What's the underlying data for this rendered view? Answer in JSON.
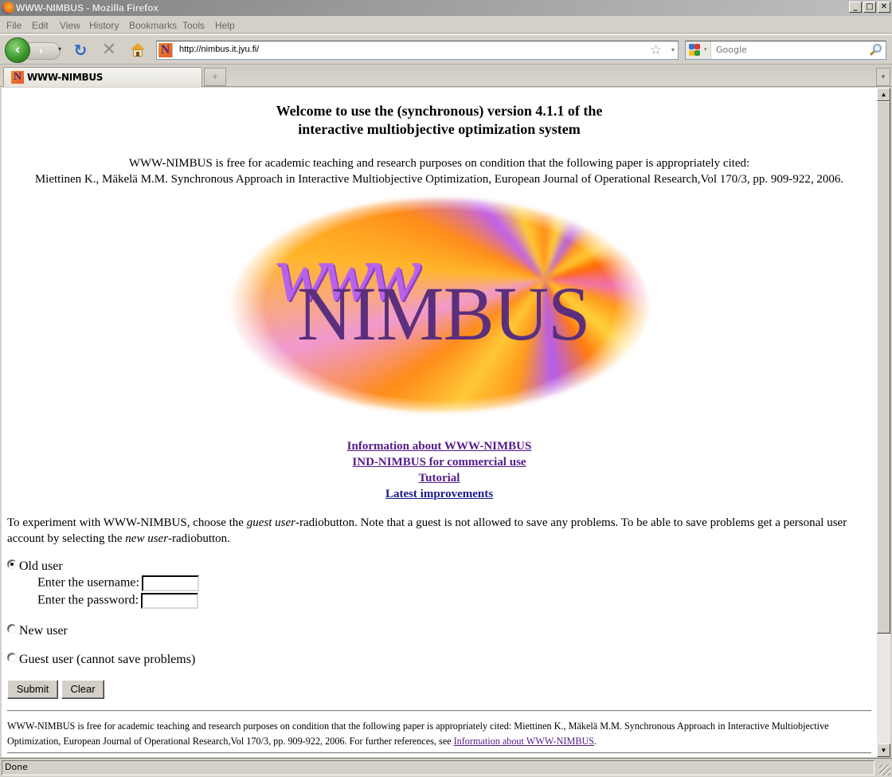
{
  "window": {
    "title": "WWW-NIMBUS - Mozilla Firefox",
    "controls": {
      "minimize": "_",
      "maximize": "□",
      "close": "✕"
    }
  },
  "menubar": {
    "items": [
      {
        "label": "File",
        "accel": "F"
      },
      {
        "label": "Edit",
        "accel": "E"
      },
      {
        "label": "View",
        "accel": "V"
      },
      {
        "label": "History",
        "accel": "s"
      },
      {
        "label": "Bookmarks",
        "accel": "B"
      },
      {
        "label": "Tools",
        "accel": "T"
      },
      {
        "label": "Help",
        "accel": "H"
      }
    ]
  },
  "navbar": {
    "back_glyph": "‹",
    "forward_glyph": "›",
    "reload_glyph": "↻",
    "stop_glyph": "✕",
    "dropdown_glyph": "▾",
    "url": "http://nimbus.it.jyu.fi/",
    "site_icon_letter": "N",
    "bookmark_star": "☆",
    "search_placeholder": "Google"
  },
  "tabs": {
    "items": [
      {
        "label": "WWW-NIMBUS",
        "active": true
      }
    ],
    "new_tab_glyph": "+",
    "all_tabs_glyph": "▾"
  },
  "page": {
    "heading_line1": "Welcome to use the (synchronous) version 4.1.1 of the",
    "heading_line2": "interactive multiobjective optimization system",
    "cite_intro_line1": "WWW-NIMBUS is free for academic teaching and research purposes on condition that the following paper is appropriately cited:",
    "cite_intro_line2": "Miettinen K., Mäkelä M.M. Synchronous Approach in Interactive Multiobjective Optimization, European Journal of Operational Research,Vol 170/3, pp. 909-922, 2006.",
    "logo": {
      "script_text": "www",
      "main_text": "NIMBUS"
    },
    "links": [
      {
        "label": "Information about WWW-NIMBUS",
        "visited": true
      },
      {
        "label": "IND-NIMBUS for commercial use",
        "visited": true
      },
      {
        "label": "Tutorial",
        "visited": true
      },
      {
        "label": "Latest improvements",
        "visited": false
      }
    ],
    "intro": {
      "part1": "To experiment with WWW-NIMBUS, choose the ",
      "em1": "guest user",
      "part2": "-radiobutton. Note that a guest is not allowed to save any problems. To be able to save problems get a personal user account by selecting the ",
      "em2": "new user",
      "part3": "-radiobutton."
    },
    "form": {
      "options": [
        {
          "label": "Old user",
          "checked": true
        },
        {
          "label": "New user",
          "checked": false
        },
        {
          "label": "Guest user (cannot save problems)",
          "checked": false
        }
      ],
      "username_label": "Enter the username:",
      "username_value": "",
      "password_label": "Enter the password:",
      "password_value": "",
      "submit_label": "Submit",
      "clear_label": "Clear"
    },
    "footer": {
      "text": "WWW-NIMBUS is free for academic teaching and research purposes on condition that the following paper is appropriately cited: Miettinen K., Mäkelä M.M. Synchronous Approach in Interactive Multiobjective Optimization, European Journal of Operational Research,Vol 170/3, pp. 909-922, 2006. For further references, see ",
      "link_label": "Information about WWW-NIMBUS",
      "trailing": "."
    }
  },
  "scrollbar": {
    "up_glyph": "▲",
    "down_glyph": "▼"
  },
  "status": {
    "text": "Done"
  },
  "colors": {
    "visited_link": "#551a8b",
    "unvisited_link": "#1a1a8b",
    "logo_purple": "#5b2f7e",
    "logo_script": "#b862ec"
  }
}
